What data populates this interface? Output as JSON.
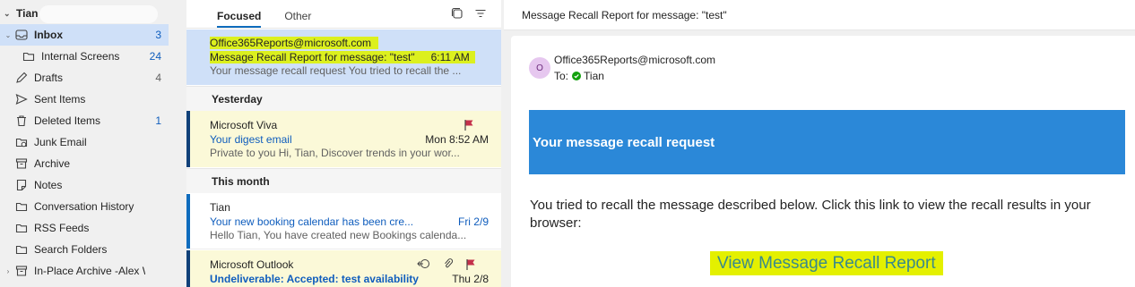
{
  "folders": {
    "account": "Tian",
    "items": [
      {
        "label": "Inbox",
        "count": "3",
        "icon": "inbox-icon",
        "selected": true,
        "caret": "v"
      },
      {
        "label": "Internal Screens",
        "count": "24",
        "icon": "folder-icon"
      },
      {
        "label": "Drafts",
        "count": "4",
        "icon": "pencil-icon"
      },
      {
        "label": "Sent Items",
        "count": "",
        "icon": "send-icon"
      },
      {
        "label": "Deleted Items",
        "count": "1",
        "icon": "trash-icon"
      },
      {
        "label": "Junk Email",
        "count": "",
        "icon": "junk-icon"
      },
      {
        "label": "Archive",
        "count": "",
        "icon": "archive-icon"
      },
      {
        "label": "Notes",
        "count": "",
        "icon": "note-icon"
      },
      {
        "label": "Conversation History",
        "count": "",
        "icon": "folder-icon"
      },
      {
        "label": "RSS Feeds",
        "count": "",
        "icon": "folder-icon"
      },
      {
        "label": "Search Folders",
        "count": "",
        "icon": "folder-icon"
      },
      {
        "label": "In-Place Archive -Alex Wi...",
        "count": "",
        "icon": "archive-icon",
        "caret": ">"
      }
    ]
  },
  "list": {
    "tabs": [
      "Focused",
      "Other"
    ],
    "groups": [
      "Yesterday",
      "This month"
    ],
    "messages": [
      {
        "sender": "Office365Reports@microsoft.com",
        "subject": "Message Recall Report for message: \"test\"",
        "time": "6:11 AM",
        "preview": "Your message recall request You tried to recall the ..."
      },
      {
        "sender": "Microsoft Viva",
        "subject": "Your digest email",
        "time": "Mon 8:52 AM",
        "preview": "Private to you Hi, Tian, Discover trends in your wor..."
      },
      {
        "sender": "Tian",
        "subject": "Your new booking calendar has been cre...",
        "time": "Fri 2/9",
        "preview": "Hello Tian, You have created new Bookings calenda..."
      },
      {
        "sender": "Microsoft Outlook",
        "subject": "Undeliverable: Accepted: test availability",
        "time": "Thu 2/8",
        "preview": ""
      }
    ]
  },
  "reading": {
    "title": "Message Recall Report for message: \"test\"",
    "avatar_initial": "O",
    "from": "Office365Reports@microsoft.com",
    "to_label": "To:",
    "to_name": "Tian",
    "banner": "Your message recall request",
    "body": "You tried to recall the message described below. Click this link to view the recall results in your browser:",
    "link": "View Message Recall Report"
  },
  "colors": {
    "accent": "#0f6cbd",
    "selected_bg": "#cfe0f8",
    "flagged_bg": "#fbf9d8",
    "flag": "#c4314b",
    "banner": "#2b88d8",
    "highlight": "#dcf01e"
  }
}
